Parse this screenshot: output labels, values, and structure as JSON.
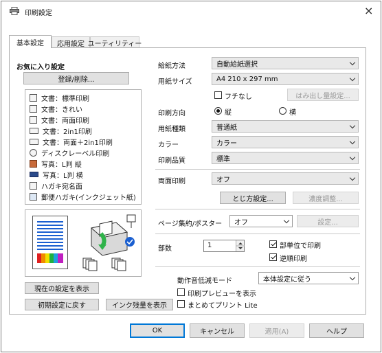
{
  "window": {
    "title": "印刷設定",
    "close_label": "×"
  },
  "tabs": [
    "基本設定",
    "応用設定",
    "ユーティリティー"
  ],
  "favorites": {
    "heading": "お気に入り設定",
    "register_button": "登録/削除...",
    "items": [
      {
        "label": "文書：標準印刷",
        "icon": "document-icon"
      },
      {
        "label": "文書：きれい",
        "icon": "document-icon"
      },
      {
        "label": "文書：両面印刷",
        "icon": "document-icon"
      },
      {
        "label": "文書：2in1印刷",
        "icon": "two-in-one-icon"
      },
      {
        "label": "文書：両面＋2in1印刷",
        "icon": "two-in-one-icon"
      },
      {
        "label": "ディスクレーベル印刷",
        "icon": "disc-icon"
      },
      {
        "label": "写真：L判 縦",
        "icon": "photo-portrait-icon"
      },
      {
        "label": "写真：L判 横",
        "icon": "photo-landscape-icon"
      },
      {
        "label": "ハガキ宛名面",
        "icon": "postcard-icon"
      },
      {
        "label": "郵便ハガキ(インクジェット紙)",
        "icon": "postcard-icon"
      }
    ]
  },
  "left_buttons": {
    "show_current": "現在の設定を表示",
    "reset_default": "初期設定に戻す",
    "ink_level": "インク残量を表示"
  },
  "settings": {
    "paper_source": {
      "label": "給紙方法",
      "value": "自動給紙選択"
    },
    "paper_size": {
      "label": "用紙サイズ",
      "value": "A4 210 x 297 mm"
    },
    "borderless": {
      "label": "フチなし",
      "checked": false
    },
    "overflow_button": "はみ出し量設定...",
    "orientation": {
      "label": "印刷方向",
      "portrait": "縦",
      "landscape": "横",
      "selected": "portrait"
    },
    "paper_type": {
      "label": "用紙種類",
      "value": "普通紙"
    },
    "color": {
      "label": "カラー",
      "value": "カラー"
    },
    "quality": {
      "label": "印刷品質",
      "value": "標準"
    },
    "duplex": {
      "label": "両面印刷",
      "value": "オフ"
    },
    "binding_button": "とじ方設定...",
    "density_button": "濃度調整...",
    "multipage": {
      "label": "ページ集約/ポスター",
      "value": "オフ"
    },
    "multipage_settings_button": "設定...",
    "copies": {
      "label": "部数",
      "value": "1"
    },
    "collate": {
      "label": "部単位で印刷",
      "checked": true
    },
    "reverse": {
      "label": "逆順印刷",
      "checked": true
    },
    "quiet_mode": {
      "label": "動作音低減モード",
      "value": "本体設定に従う"
    },
    "preview": {
      "label": "印刷プレビューを表示",
      "checked": false
    },
    "lite": {
      "label": "まとめてプリント Lite",
      "checked": false
    }
  },
  "footer": {
    "ok": "OK",
    "cancel": "キャンセル",
    "apply": "適用(A)",
    "help": "ヘルプ"
  },
  "colors": {
    "accent": "#0078d7",
    "preview_blue": "#1a5fd0",
    "printer_arrow": "#2fb34a"
  }
}
